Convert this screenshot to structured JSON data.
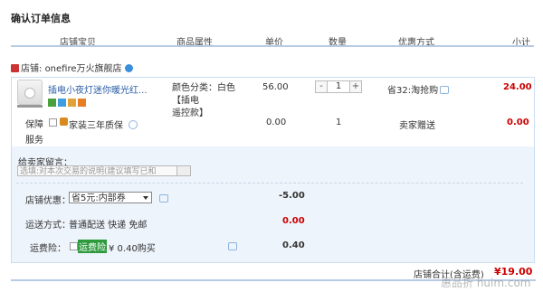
{
  "title": "确认订单信息",
  "columns": [
    "店铺宝贝",
    "商品属性",
    "单价",
    "数量",
    "优惠方式",
    "小计"
  ],
  "shop": {
    "prefix": "店铺:",
    "name": "onefire万火旗舰店"
  },
  "item": {
    "name": "插电小夜灯迷你暖光红...",
    "attr_line1": "颜色分类：白色【插电",
    "attr_line2": "遥控款】",
    "price": "56.00",
    "quantity": "1",
    "minus": "-",
    "plus": "+",
    "promo": "省32:淘抢购",
    "subtotal": "24.00"
  },
  "guarantee": {
    "label": "保障服务",
    "text": "家装三年质保",
    "price": "0.00",
    "quantity": "1",
    "promo": "卖家赠送",
    "subtotal": "0.00"
  },
  "message": {
    "label": "给卖家留言：",
    "placeholder": "选填:对本次交易的说明(建议填写已和"
  },
  "discount": {
    "label": "店铺优惠：",
    "selected": "省5元:内部券",
    "amount": "-5.00"
  },
  "shipping": {
    "label": "运送方式：",
    "method": "普通配送 快递 免邮",
    "amount": "0.00"
  },
  "insurance": {
    "label": "运费险：",
    "badge": "运费险",
    "text": "¥ 0.40购买",
    "amount": "0.40"
  },
  "total": {
    "label": "店铺合计(含运费)",
    "amount": "¥19.00"
  },
  "watermark": "惠品折 huim.com",
  "colors": {
    "accent_red": "#cc0000",
    "link_blue": "#2b5ea8",
    "panel_bg": "#eef4fb",
    "border": "#c9ddf2"
  }
}
